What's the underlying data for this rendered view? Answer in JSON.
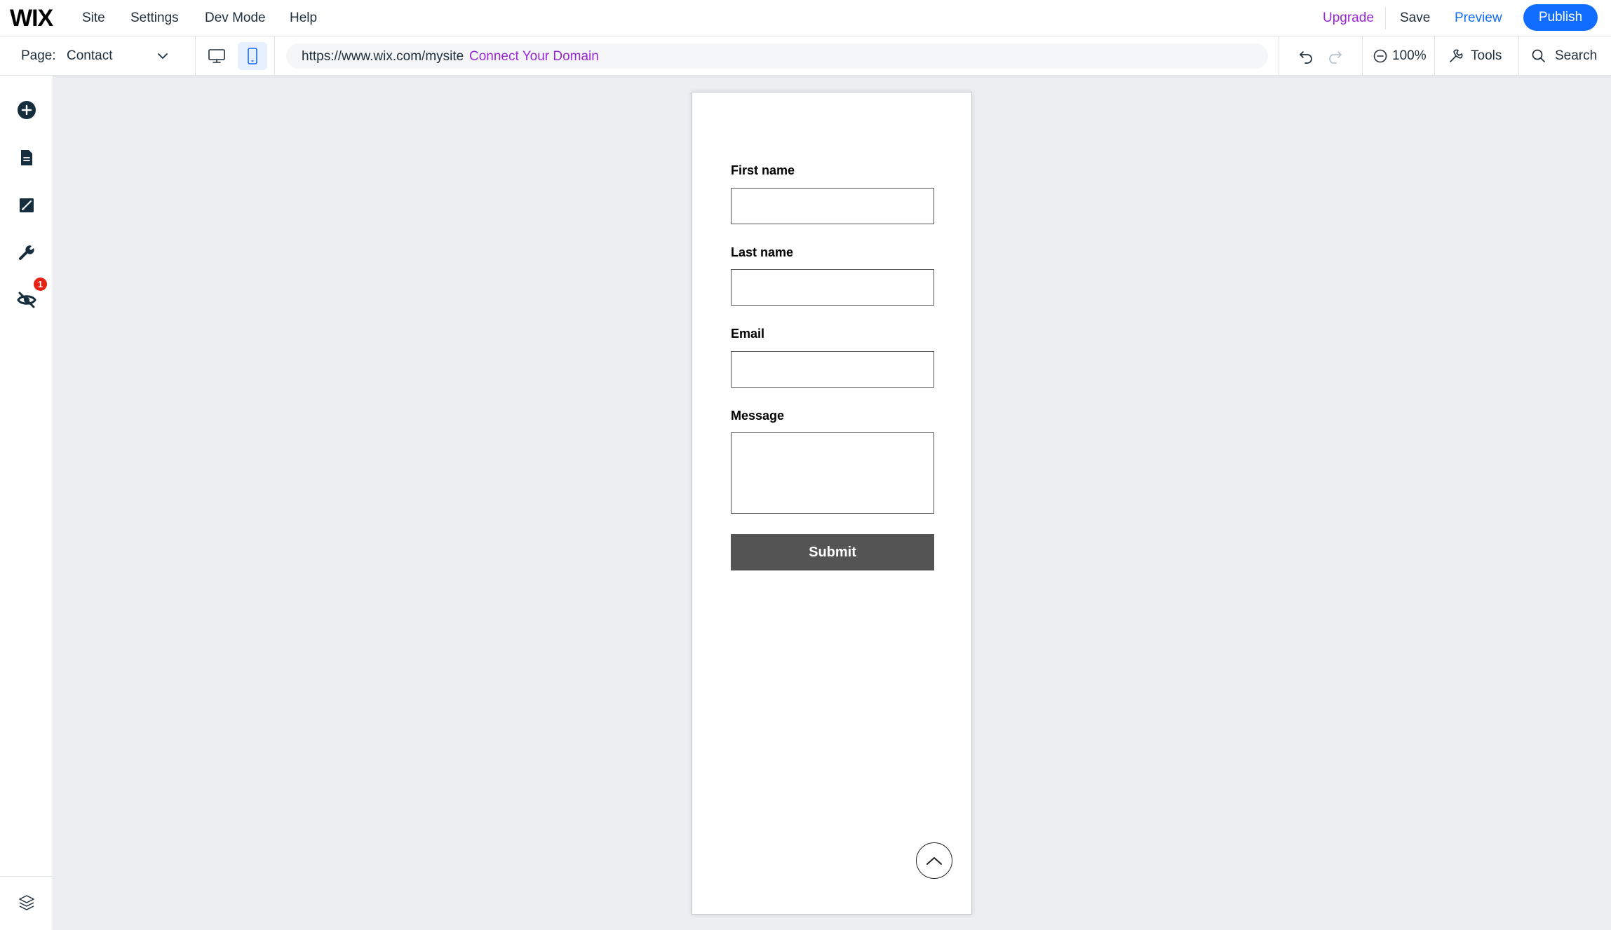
{
  "brand": {
    "logo_text": "WIX"
  },
  "menu": {
    "items": [
      {
        "label": "Site"
      },
      {
        "label": "Settings"
      },
      {
        "label": "Dev Mode"
      },
      {
        "label": "Help"
      }
    ],
    "upgrade_label": "Upgrade",
    "save_label": "Save",
    "preview_label": "Preview",
    "publish_label": "Publish"
  },
  "toolbar": {
    "page_label": "Page:",
    "page_value": "Contact",
    "active_device": "mobile",
    "url": "https://www.wix.com/mysite",
    "connect_domain_label": "Connect Your Domain",
    "zoom_label": "100%",
    "tools_label": "Tools",
    "search_label": "Search"
  },
  "sidebar": {
    "items": [
      {
        "icon": "add-icon"
      },
      {
        "icon": "pages-icon"
      },
      {
        "icon": "design-icon"
      },
      {
        "icon": "tools-wrench-icon"
      },
      {
        "icon": "hidden-elements-icon"
      }
    ],
    "badge_count": "1",
    "bottom_icon": "layers-icon"
  },
  "form": {
    "fields": [
      {
        "label": "First name",
        "value": ""
      },
      {
        "label": "Last name",
        "value": ""
      },
      {
        "label": "Email",
        "value": ""
      },
      {
        "label": "Message",
        "value": ""
      }
    ],
    "submit_label": "Submit"
  },
  "colors": {
    "accent_blue": "#116dff",
    "upgrade_purple": "#9a27d5",
    "badge_red": "#e62214",
    "submit_gray": "#545454",
    "canvas_bg": "#eceef2"
  }
}
